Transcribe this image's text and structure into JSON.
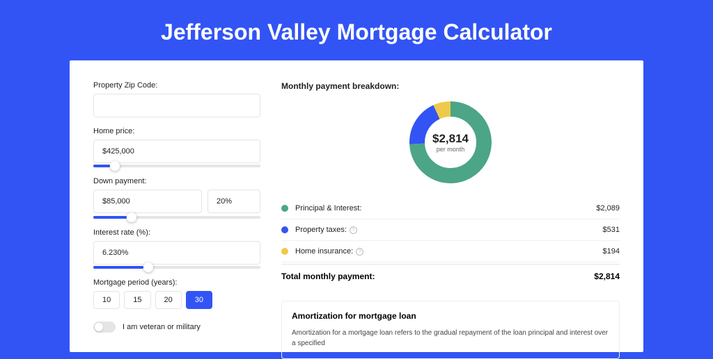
{
  "title": "Jefferson Valley Mortgage Calculator",
  "form": {
    "zip_label": "Property Zip Code:",
    "zip_value": "",
    "price_label": "Home price:",
    "price_value": "$425,000",
    "down_label": "Down payment:",
    "down_value": "$85,000",
    "down_pct": "20%",
    "rate_label": "Interest rate (%):",
    "rate_value": "6.230%",
    "period_label": "Mortgage period (years):",
    "periods": [
      "10",
      "15",
      "20",
      "30"
    ],
    "period_active": "30",
    "veteran_label": "I am veteran or military"
  },
  "breakdown": {
    "heading": "Monthly payment breakdown:",
    "center_value": "$2,814",
    "center_sub": "per month",
    "items": [
      {
        "label": "Principal & Interest:",
        "value": "$2,089"
      },
      {
        "label": "Property taxes:",
        "value": "$531",
        "info": true
      },
      {
        "label": "Home insurance:",
        "value": "$194",
        "info": true
      }
    ],
    "total_label": "Total monthly payment:",
    "total_value": "$2,814"
  },
  "amort": {
    "heading": "Amortization for mortgage loan",
    "text": "Amortization for a mortgage loan refers to the gradual repayment of the loan principal and interest over a specified"
  },
  "chart_data": {
    "type": "pie",
    "title": "Monthly payment breakdown",
    "series": [
      {
        "name": "Principal & Interest",
        "value": 2089,
        "color": "#4ba586"
      },
      {
        "name": "Property taxes",
        "value": 531,
        "color": "#3254f4"
      },
      {
        "name": "Home insurance",
        "value": 194,
        "color": "#f0c94a"
      }
    ],
    "total": 2814
  }
}
